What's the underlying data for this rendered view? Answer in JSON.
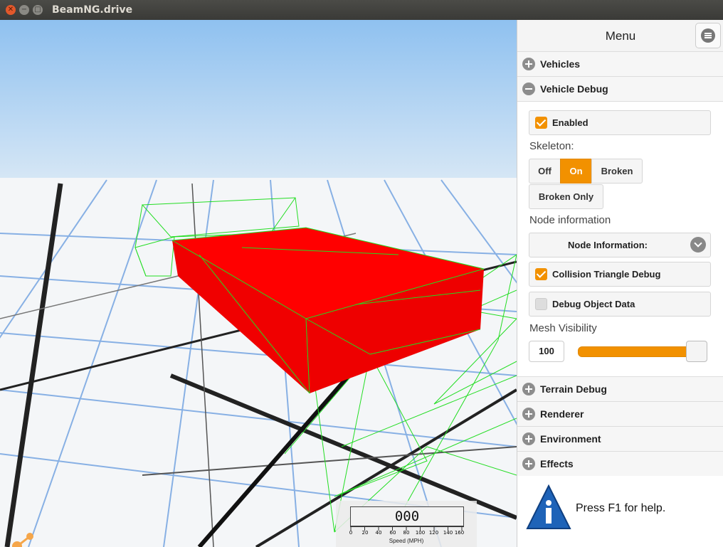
{
  "window": {
    "title": "BeamNG.drive"
  },
  "hud": {
    "speed_value": "000",
    "speed_ticks": [
      "0",
      "20",
      "40",
      "60",
      "80",
      "100",
      "120",
      "140",
      "160"
    ],
    "speed_caption": "Speed (MPH)"
  },
  "menu": {
    "title": "Menu",
    "sections": {
      "vehicles": "Vehicles",
      "vehicle_debug": "Vehicle Debug",
      "terrain_debug": "Terrain Debug",
      "renderer": "Renderer",
      "environment": "Environment",
      "effects": "Effects"
    },
    "vehicle_debug": {
      "enabled_label": "Enabled",
      "enabled": true,
      "skeleton_label": "Skeleton:",
      "skeleton_options": [
        "Off",
        "On",
        "Broken",
        "Broken Only"
      ],
      "skeleton_selected": "On",
      "node_info_label": "Node information",
      "node_info_value": "Node Information:",
      "collision_label": "Collision Triangle Debug",
      "collision_enabled": true,
      "object_data_label": "Debug Object Data",
      "object_data_enabled": false,
      "mesh_label": "Mesh Visibility",
      "mesh_value": "100",
      "mesh_fraction": 1.0
    },
    "help_text": "Press F1 for help."
  },
  "colors": {
    "accent": "#f29100",
    "vehicle": "#ff0000",
    "wireframe": "#22dd22",
    "sky_top": "#8fc1f0"
  }
}
